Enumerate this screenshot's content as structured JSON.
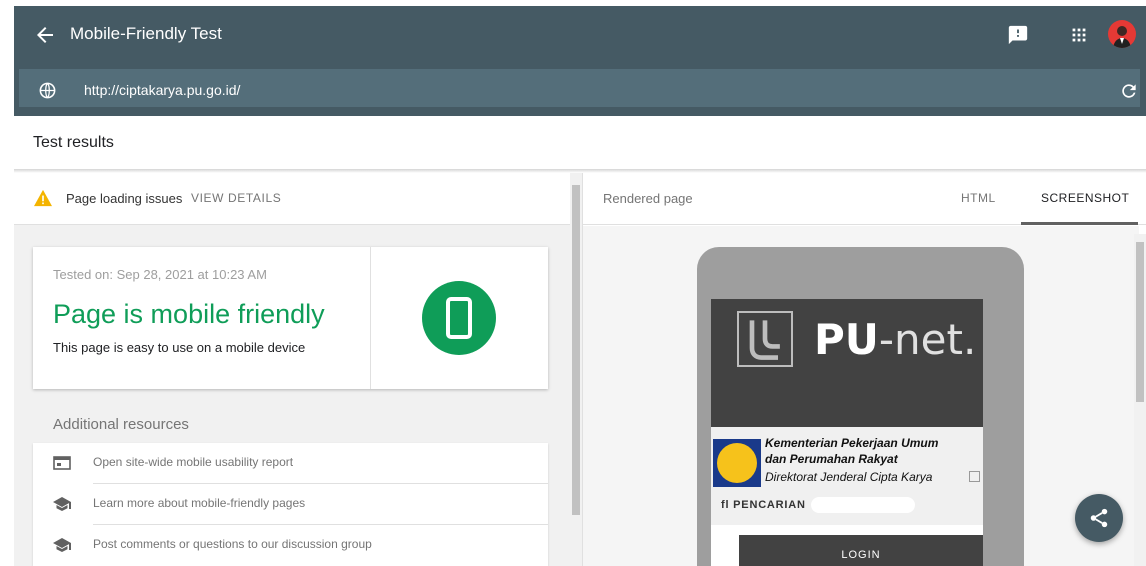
{
  "header": {
    "title": "Mobile-Friendly Test",
    "icons": [
      "back-arrow-icon",
      "feedback-icon",
      "apps-grid-icon",
      "account-avatar"
    ]
  },
  "urlbar": {
    "url": "http://ciptakarya.pu.go.id/"
  },
  "results": {
    "title": "Test results",
    "issues_label": "Page loading issues",
    "view_details": "VIEW DETAILS"
  },
  "card": {
    "tested_on": "Tested on: Sep 28, 2021 at 10:23 AM",
    "verdict": "Page is mobile friendly",
    "subtitle": "This page is easy to use on a mobile device"
  },
  "resources": {
    "heading": "Additional resources",
    "items": [
      {
        "label": "Open site-wide mobile usability report",
        "icon": "report-icon"
      },
      {
        "label": "Learn more about mobile-friendly pages",
        "icon": "school-icon"
      },
      {
        "label": "Post comments or questions to our discussion group",
        "icon": "school-icon"
      }
    ]
  },
  "rendered": {
    "label": "Rendered page",
    "tabs": [
      "HTML",
      "SCREENSHOT"
    ],
    "active_tab": "SCREENSHOT"
  },
  "preview": {
    "brand_bold": "PU",
    "brand_rest": "-net.",
    "ministry_line1": "Kementerian Pekerjaan Umum",
    "ministry_line2": "dan Perumahan Rakyat",
    "ministry_line3": "Direktorat Jenderal Cipta Karya",
    "search_label": "fl PENCARIAN",
    "login_label": "LOGIN"
  },
  "colors": {
    "appbar": "#455a64",
    "success": "#0f9d58",
    "warning": "#f4b400"
  }
}
